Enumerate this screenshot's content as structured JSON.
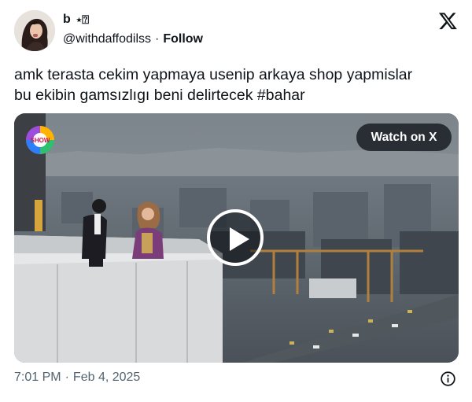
{
  "author": {
    "name": "b",
    "name_decoration": "⋆⍰",
    "handle": "@withdaffodilss",
    "separator": "·",
    "follow_label": "Follow",
    "avatar_icon": "profile-photo"
  },
  "platform_icon": "x-logo-icon",
  "tweet": {
    "text_line1": "amk terasta cekim yapmaya usenip arkaya shop yapmislar",
    "text_line2_before_tag": "bu ekibin gamsızlıgı beni delirtecek ",
    "hashtag": "#bahar"
  },
  "media": {
    "type": "video",
    "watch_label": "Watch on X",
    "channel_logo_text": "SHOW",
    "play_icon": "play-icon"
  },
  "footer": {
    "time": "7:01 PM",
    "separator": "·",
    "date": "Feb 4, 2025",
    "info_icon": "info-icon"
  },
  "colors": {
    "text_primary": "#0f1419",
    "text_secondary": "#536471",
    "overlay_dark": "#0f1419"
  }
}
